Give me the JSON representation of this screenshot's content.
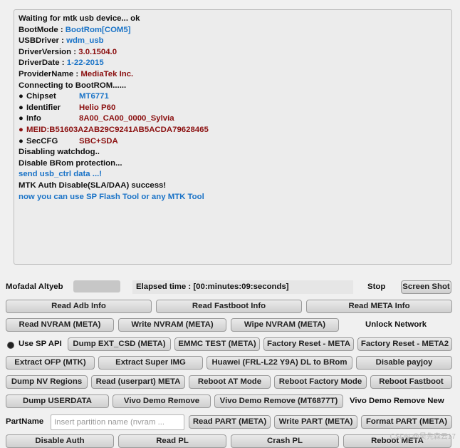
{
  "log": {
    "lines": [
      {
        "label": "Waiting for mtk usb device... ok"
      },
      {
        "label": "BootMode : ",
        "value": "BootRom[COM5]"
      },
      {
        "label": "USBDriver : ",
        "value": "wdm_usb"
      },
      {
        "label": "DriverVersion : ",
        "value": "3.0.1504.0"
      },
      {
        "label": "DriverDate : ",
        "value": "1-22-2015"
      },
      {
        "label": "ProviderName : ",
        "value": "MediaTek Inc."
      },
      {
        "label": "Connecting to BootROM......"
      },
      {
        "label": "Chipset",
        "value": "MT6771"
      },
      {
        "label": "Identifier",
        "value": "Helio P60"
      },
      {
        "label": "Info",
        "value": "8A00_CA00_0000_Sylvia"
      },
      {
        "label": "MEID:B51603A2AB29C9241AB5ACDA79628465"
      },
      {
        "label": "SecCFG",
        "value": "SBC+SDA"
      },
      {
        "label": "Disabling watchdog.."
      },
      {
        "label": "Disable BRom protection..."
      },
      {
        "label": "send usb_ctrl data ...!"
      },
      {
        "label": "MTK Auth Disable(SLA/DAA) success!"
      },
      {
        "label": "now you can use SP Flash Tool or any MTK Tool"
      }
    ]
  },
  "status": {
    "author": "Mofadal Altyeb",
    "elapsed": "Elapsed time : [00:minutes:09:seconds]",
    "stop": "Stop",
    "progress": 0
  },
  "buttons": {
    "screen_shot": "Screen Shot",
    "read_adb": "Read Adb Info",
    "read_fastboot": "Read Fastboot Info",
    "read_meta": "Read META Info",
    "read_nvram": "Read NVRAM (META)",
    "write_nvram": "Write NVRAM (META)",
    "wipe_nvram": "Wipe NVRAM (META)",
    "unlock_network": "Unlock Network",
    "use_sp_api": "Use SP API",
    "dump_ext_csd": "Dump  EXT_CSD (META)",
    "emmc_test": "EMMC TEST (META)",
    "factory_reset_meta": "Factory Reset - META",
    "factory_reset_meta2": "Factory Reset - META2",
    "extract_ofp": "Extract OFP (MTK)",
    "extract_super": "Extract Super IMG",
    "huawei_dl": "Huawei (FRL-L22 Y9A) DL to BRom",
    "disable_payjoy": "Disable payjoy",
    "dump_nv": "Dump NV Regions",
    "read_userpart": "Read (userpart) META",
    "reboot_at": "Reboot AT Mode",
    "reboot_factory": "Reboot Factory Mode",
    "reboot_fastboot": "Reboot Fastboot",
    "dump_userdata": "Dump USERDATA",
    "vivo_demo_remove": "Vivo Demo Remove",
    "vivo_demo_remove_mt": "Vivo Demo Remove (MT6877T)",
    "vivo_demo_remove_new": "Vivo Demo Remove New",
    "partname": "PartName",
    "read_part": "Read PART (META)",
    "write_part": "Write PART (META)",
    "format_part": "Format PART (META)",
    "disable_auth": "Disable Auth",
    "read_pl": "Read PL",
    "crash_pl": "Crash PL",
    "reboot_meta": "Reboot META"
  },
  "partition_input": {
    "placeholder": "Insert partition name (nvram ...",
    "value": ""
  },
  "watermark": "CSDN @吴先森云17",
  "colors": {
    "blue": "#1a73c7",
    "dark_red": "#8b1010"
  }
}
